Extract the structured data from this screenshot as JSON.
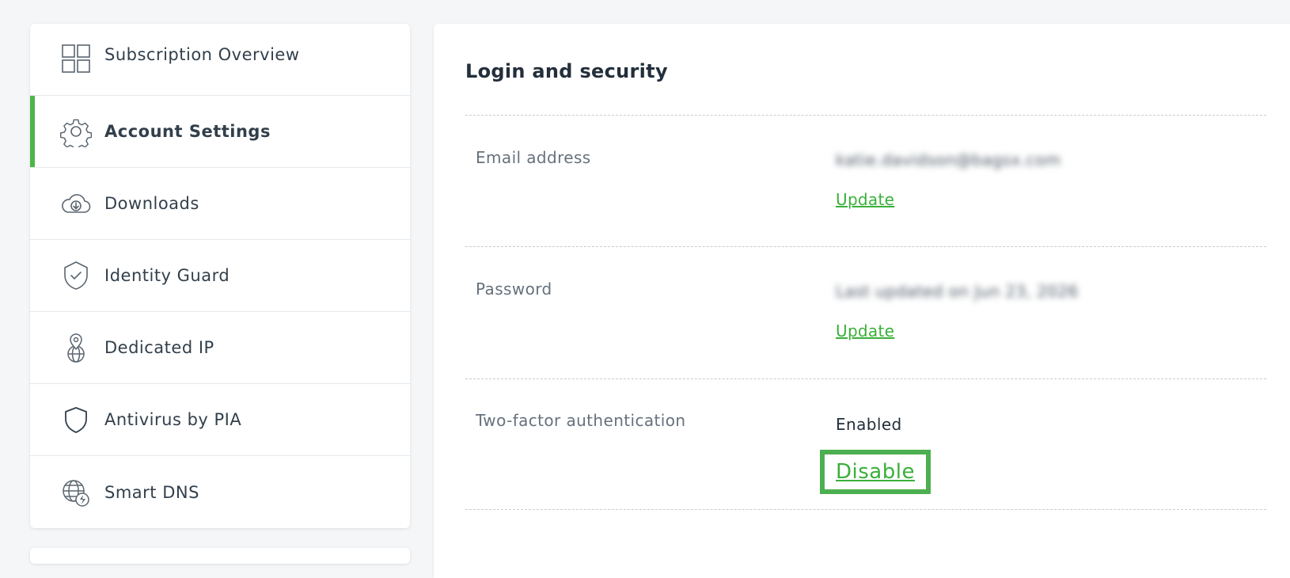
{
  "sidebar": {
    "items": [
      {
        "label": "Subscription Overview",
        "icon": "grid-icon",
        "active": false
      },
      {
        "label": "Account Settings",
        "icon": "gear-icon",
        "active": true
      },
      {
        "label": "Downloads",
        "icon": "cloud-download-icon",
        "active": false
      },
      {
        "label": "Identity Guard",
        "icon": "shield-check-icon",
        "active": false
      },
      {
        "label": "Dedicated IP",
        "icon": "globe-pin-icon",
        "active": false
      },
      {
        "label": "Antivirus by PIA",
        "icon": "shield-icon",
        "active": false
      },
      {
        "label": "Smart DNS",
        "icon": "globe-bolt-icon",
        "active": false
      }
    ],
    "accent_color": "#4cb649"
  },
  "main": {
    "section_title": "Login and security",
    "rows": {
      "email": {
        "label": "Email address",
        "value": "katie.davidson@bagsx.com",
        "action": "Update"
      },
      "password": {
        "label": "Password",
        "value": "Last updated on Jun 23, 2026",
        "action": "Update"
      },
      "two_factor": {
        "label": "Two-factor authentication",
        "status": "Enabled",
        "action": "Disable"
      }
    },
    "link_color": "#3ab03a",
    "highlight_color": "#4caf50"
  }
}
